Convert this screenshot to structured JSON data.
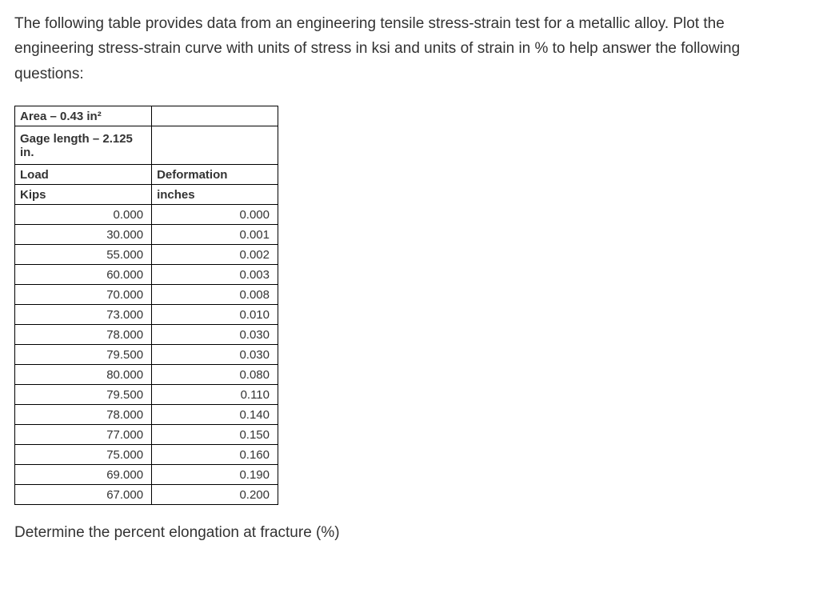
{
  "intro": "The following table provides data from an engineering tensile stress-strain test for a metallic alloy. Plot the engineering stress-strain curve with units of stress in ksi and units of strain in % to help answer the following questions:",
  "table": {
    "area_label": "Area – 0.43 in²",
    "gage_label": "Gage length – 2.125 in.",
    "col1_header": "Load",
    "col2_header": "Deformation",
    "col1_unit": "Kips",
    "col2_unit": "inches",
    "rows": [
      {
        "load": "0.000",
        "deformation": "0.000"
      },
      {
        "load": "30.000",
        "deformation": "0.001"
      },
      {
        "load": "55.000",
        "deformation": "0.002"
      },
      {
        "load": "60.000",
        "deformation": "0.003"
      },
      {
        "load": "70.000",
        "deformation": "0.008"
      },
      {
        "load": "73.000",
        "deformation": "0.010"
      },
      {
        "load": "78.000",
        "deformation": "0.030"
      },
      {
        "load": "79.500",
        "deformation": "0.030"
      },
      {
        "load": "80.000",
        "deformation": "0.080"
      },
      {
        "load": "79.500",
        "deformation": "0.110"
      },
      {
        "load": "78.000",
        "deformation": "0.140"
      },
      {
        "load": "77.000",
        "deformation": "0.150"
      },
      {
        "load": "75.000",
        "deformation": "0.160"
      },
      {
        "load": "69.000",
        "deformation": "0.190"
      },
      {
        "load": "67.000",
        "deformation": "0.200"
      }
    ]
  },
  "question": "Determine the percent elongation at fracture (%)"
}
